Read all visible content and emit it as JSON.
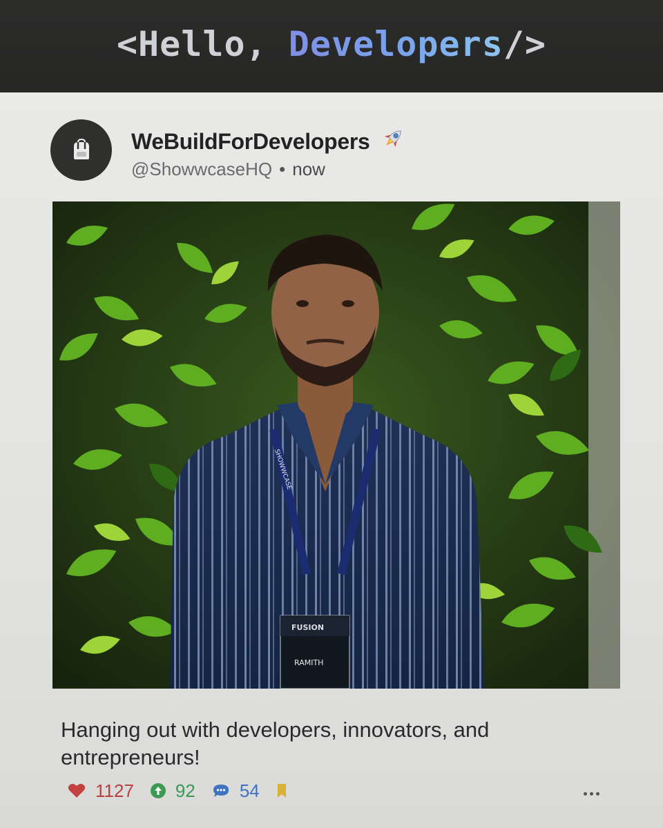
{
  "banner": {
    "open": "<Hello, ",
    "accent": "Developers",
    "close": "/>"
  },
  "post": {
    "author": "WeBuildForDevelopers",
    "author_icon": "rocket-icon",
    "handle": "@ShowwcaseHQ",
    "separator": "•",
    "time": "now",
    "caption": "Hanging out with developers, innovators, and entrepreneurs!",
    "reactions": {
      "likes": "1127",
      "upvotes": "92",
      "comments": "54"
    },
    "photo": {
      "badge_name": "RAMITH",
      "badge_event": "FUSION",
      "lanyard_text": "SHOWWCASE"
    }
  },
  "colors": {
    "heart": "#c2403d",
    "upvote": "#3c9a55",
    "comment": "#3f73c2",
    "bookmark": "#d9b23a",
    "banner_accent": "#7f9ae8"
  }
}
